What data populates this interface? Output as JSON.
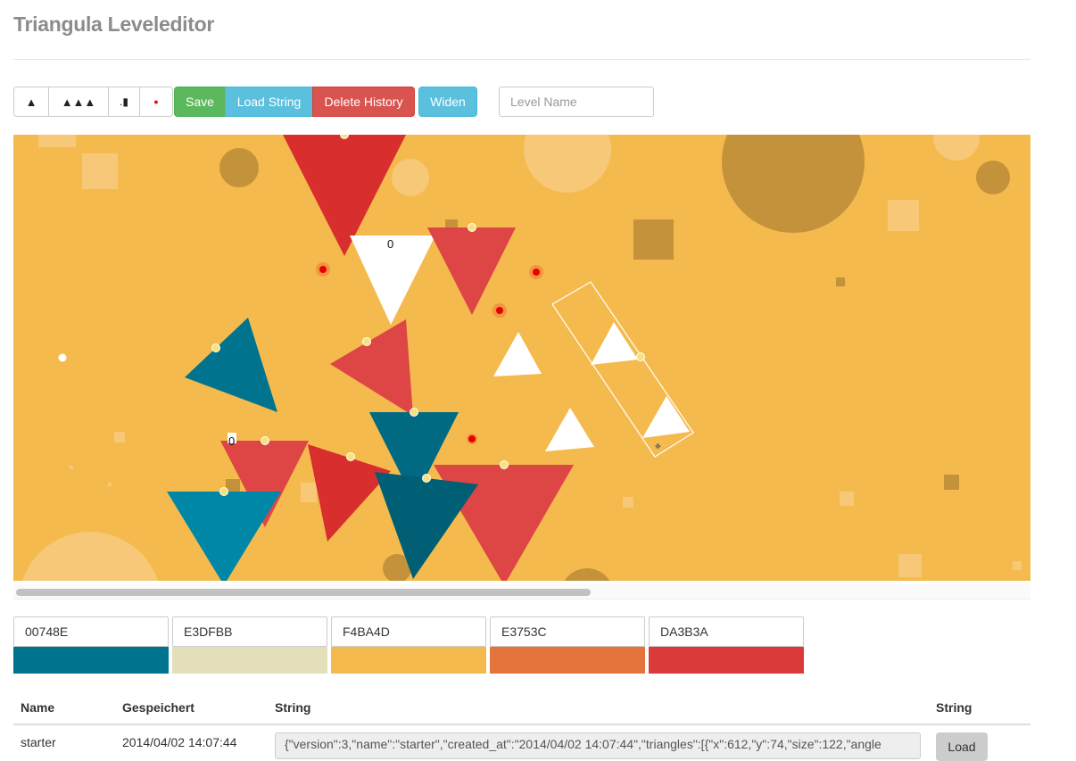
{
  "app": {
    "title": "Triangula Leveleditor"
  },
  "toolbar": {
    "tool_triangle": "▲",
    "tool_multi": "▲▲▲",
    "tool_bar": ".▮",
    "tool_dot": "●",
    "save_label": "Save",
    "load_string_label": "Load String",
    "delete_history_label": "Delete History",
    "widen_label": "Widen",
    "level_name_placeholder": "Level Name",
    "level_name_value": ""
  },
  "canvas": {
    "background_color": "#F4BA4D",
    "labels": [
      "0",
      "0"
    ]
  },
  "palette": [
    {
      "hex": "00748E",
      "color": "#00748E"
    },
    {
      "hex": "E3DFBB",
      "color": "#E3DFBB"
    },
    {
      "hex": "F4BA4D",
      "color": "#F4BA4D"
    },
    {
      "hex": "E3753C",
      "color": "#E3753C"
    },
    {
      "hex": "DA3B3A",
      "color": "#DA3B3A"
    }
  ],
  "table": {
    "headers": [
      "Name",
      "Gespeichert",
      "String",
      "String"
    ],
    "rows": [
      {
        "name": "starter",
        "saved": "2014/04/02 14:07:44",
        "string": "{\"version\":3,\"name\":\"starter\",\"created_at\":\"2014/04/02 14:07:44\",\"triangles\":[{\"x\":612,\"y\":74,\"size\":122,\"angle",
        "load_label": "Load"
      }
    ]
  }
}
